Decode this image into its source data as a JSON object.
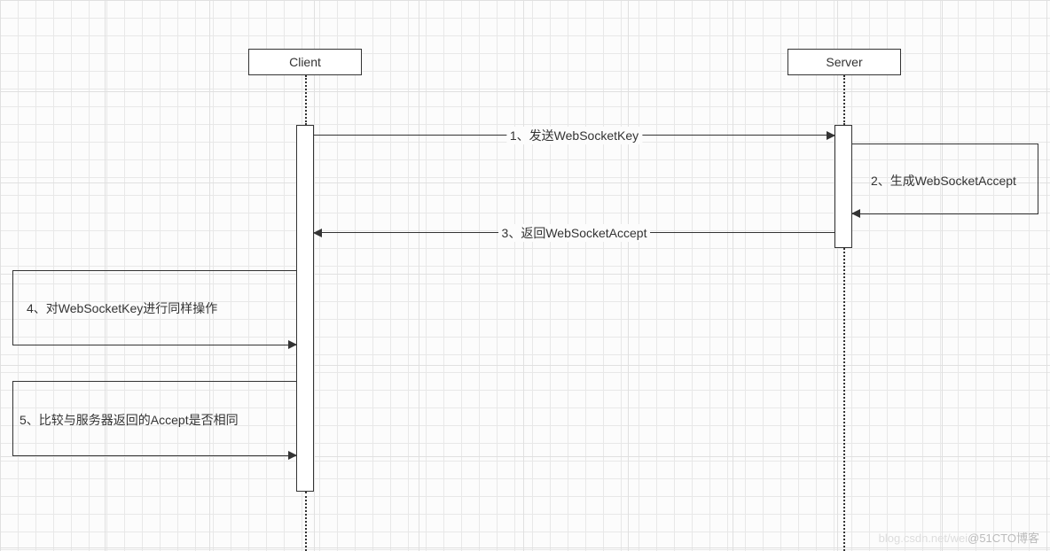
{
  "participants": {
    "client": "Client",
    "server": "Server"
  },
  "messages": {
    "m1": "1、发送WebSocketKey",
    "m2": "2、生成WebSocketAccept",
    "m3": "3、返回WebSocketAccept",
    "m4": "4、对WebSocketKey进行同样操作",
    "m5": "5、比较与服务器返回的Accept是否相同"
  },
  "watermark": "@51CTO博客"
}
